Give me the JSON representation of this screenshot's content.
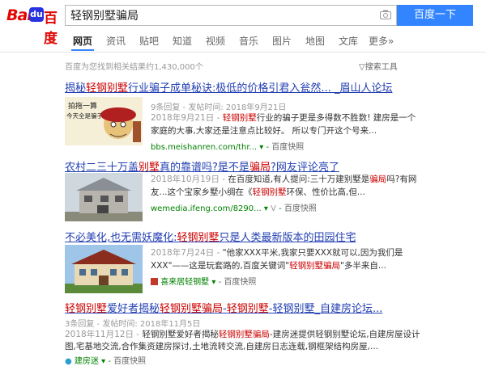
{
  "search": {
    "query": "轻钢别墅骗局",
    "button_label": "百度一下"
  },
  "logo": {
    "text1": "Bai",
    "text2": "du",
    "text3": "百度"
  },
  "tabs": [
    "网页",
    "资讯",
    "贴吧",
    "知道",
    "视频",
    "音乐",
    "图片",
    "地图",
    "文库",
    "更多»"
  ],
  "result_count": "百度为您找到相关结果约1,430,000个",
  "search_tools": "搜索工具",
  "results": [
    {
      "title_a": "揭秘",
      "title_hl1": "轻钢别墅",
      "title_b": "行业骗子成单秘诀:极低的价格引君入瓮然... _眉山人论坛",
      "meta": "9条回复 - 发帖时间: 2018年9月21日",
      "abs1_date": "2018年9月21日 - ",
      "abs1_hl": "轻钢别墅",
      "abs1_rest": "行业的骗子更是多得数不胜数! 建房是一个",
      "abs2": "家庭的大事,大家还是注意点比较好。 所以专门开这个号来...",
      "url": "bbs.meishanren.com/thr...",
      "snapshot": "百度快照",
      "thumb_text1": "拍拖一算",
      "thumb_text2": "今天全是骗子"
    },
    {
      "title_a": "农村二三十万盖",
      "title_hl1": "别墅",
      "title_b": "真的靠谱吗?是不是",
      "title_hl2": "骗局",
      "title_c": "?网友评论亮了",
      "abs1_date": "2018年10月19日 - ",
      "abs1_a": "在百度知道,有人提问:三十万建别墅是",
      "abs1_hl": "骗局",
      "abs1_b": "吗?有网",
      "abs2_a": "友...这个宝家乡墅小绸在《",
      "abs2_hl": "轻钢别墅",
      "abs2_b": "环保、性价比高,但...",
      "url": "wemedia.ifeng.com/8290...",
      "snapshot": "百度快照"
    },
    {
      "title_a": "不必美化,也无需妖魔化:",
      "title_hl1": "轻钢别墅",
      "title_b": "只是人类最新版本的田园住宅",
      "abs1_date": "2018年7月24日 - ",
      "abs1_rest": "\"他家XXX平米,我家只要XXX就可以,因为我们是",
      "abs2_a": "XXX\"——这是玩套路的,百度关键词\"",
      "abs2_hl": "轻钢别墅骗局",
      "abs2_b": "\"多半来自...",
      "source": "喜来居轻钢墅",
      "snapshot": "百度快照"
    },
    {
      "title_hl1": "轻钢别墅",
      "title_a": "爱好者揭秘",
      "title_hl2": "轻钢别墅骗局",
      "title_b": "-",
      "title_hl3": "轻钢别墅",
      "title_c": "-轻钢别墅_自建房论坛...",
      "meta": "3条回复 - 发帖时间: 2018年11月5日",
      "abs1_date": "2018年11月12日 - ",
      "abs1_a": "轻钢别墅爱好者揭秘",
      "abs1_hl": "轻钢别墅骗局",
      "abs1_b": "-建房迷提供轻钢别墅论坛,自建房屋设计",
      "abs2": "图,宅基地交流,合作集资建房探讨,土地流转交流,自建房日志连载,钢框架结构房屋,...",
      "source": "建房迷",
      "snapshot": "百度快照"
    }
  ],
  "colors": {
    "link": "#2440b3",
    "highlight": "#cc0000",
    "url_green": "#008000",
    "button": "#3385ff",
    "logo_red": "#e10602",
    "logo_blue": "#2932e1"
  }
}
